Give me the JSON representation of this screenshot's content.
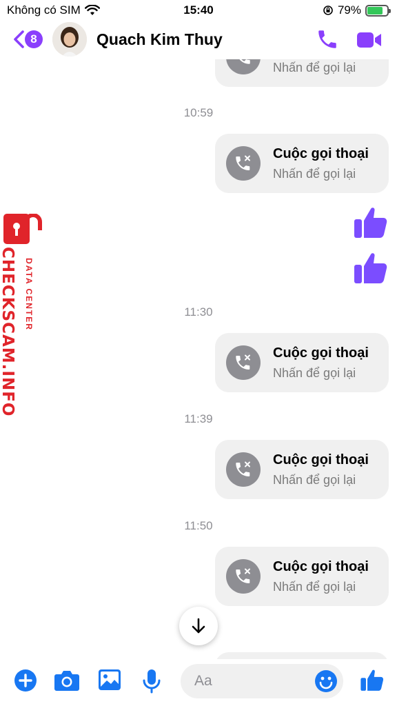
{
  "status_bar": {
    "carrier": "Không có SIM",
    "time": "15:40",
    "battery_percent": "79%",
    "battery_level": 0.79
  },
  "header": {
    "unread_count": "8",
    "contact_name": "Quach Kim Thuy"
  },
  "colors": {
    "accent": "#8a3ffc",
    "like": "#7b4dff",
    "composer": "#1877f2"
  },
  "call_text": {
    "title": "Cuộc gọi thoại",
    "subtitle": "Nhấn để gọi lại"
  },
  "messages": [
    {
      "type": "call",
      "subtitle": "Nhấn để gọi lại",
      "partial": true
    },
    {
      "type": "timestamp",
      "text": "10:59"
    },
    {
      "type": "call",
      "title": "Cuộc gọi thoại",
      "subtitle": "Nhấn để gọi lại"
    },
    {
      "type": "like"
    },
    {
      "type": "like"
    },
    {
      "type": "timestamp",
      "text": "11:30"
    },
    {
      "type": "call",
      "title": "Cuộc gọi thoại",
      "subtitle": "Nhấn để gọi lại"
    },
    {
      "type": "timestamp",
      "text": "11:39"
    },
    {
      "type": "call",
      "title": "Cuộc gọi thoại",
      "subtitle": "Nhấn để gọi lại"
    },
    {
      "type": "timestamp",
      "text": "11:50"
    },
    {
      "type": "call",
      "title": "Cuộc gọi thoại",
      "subtitle": "Nhấn để gọi lại"
    }
  ],
  "watermark": {
    "main": "CHECKSCAM.INFO",
    "sub": "DATA CENTER"
  },
  "composer": {
    "placeholder": "Aa",
    "icons": [
      "plus-icon",
      "camera-icon",
      "image-icon",
      "microphone-icon",
      "emoji-icon",
      "thumbs-up-icon"
    ]
  }
}
